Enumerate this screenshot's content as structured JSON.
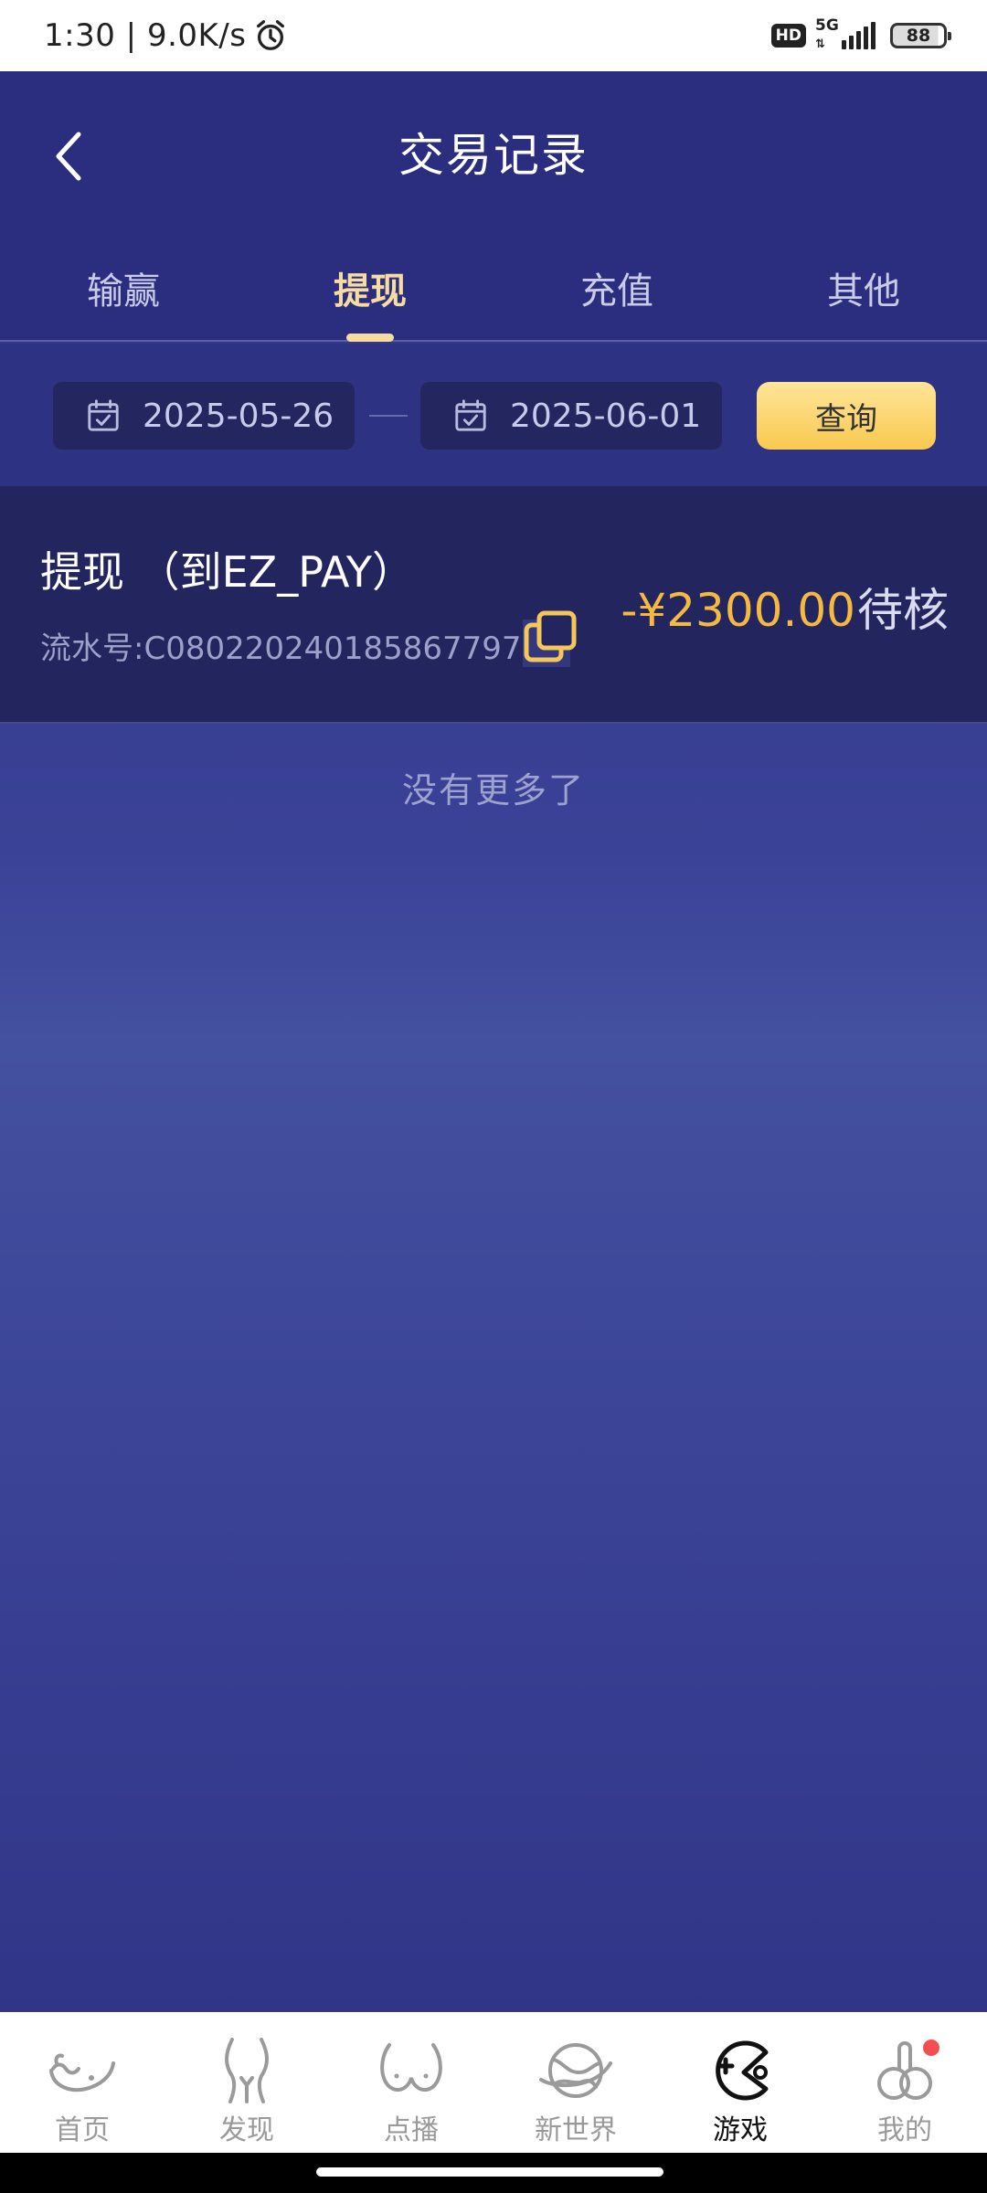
{
  "status_bar": {
    "time": "1:30",
    "speed": "9.0K/s",
    "hd": "HD",
    "network": "5G",
    "battery": "88"
  },
  "header": {
    "title": "交易记录"
  },
  "tabs": [
    {
      "label": "输赢",
      "active": false
    },
    {
      "label": "提现",
      "active": true
    },
    {
      "label": "充值",
      "active": false
    },
    {
      "label": "其他",
      "active": false
    }
  ],
  "filter": {
    "start_date": "2025-05-26",
    "end_date": "2025-06-01",
    "query_label": "查询"
  },
  "records": [
    {
      "title": "提现 （到EZ_PAY）",
      "serial": "流水号:C080220240185867797",
      "amount": "-¥2300.00",
      "status": "待核"
    }
  ],
  "list_end_text": "没有更多了",
  "bottom_nav": [
    {
      "label": "首页",
      "icon": "home-icon",
      "active": false
    },
    {
      "label": "发现",
      "icon": "discover-icon",
      "active": false
    },
    {
      "label": "点播",
      "icon": "vod-icon",
      "active": false
    },
    {
      "label": "新世界",
      "icon": "planet-icon",
      "active": false
    },
    {
      "label": "游戏",
      "icon": "game-icon",
      "active": true
    },
    {
      "label": "我的",
      "icon": "profile-icon",
      "active": false,
      "badge": true
    }
  ],
  "colors": {
    "header_bg": "#2b2e7f",
    "accent_gold": "#f7dca2",
    "amount_orange": "#f5b940",
    "button_yellow": "#f9c94f",
    "record_bg": "#23255f"
  }
}
